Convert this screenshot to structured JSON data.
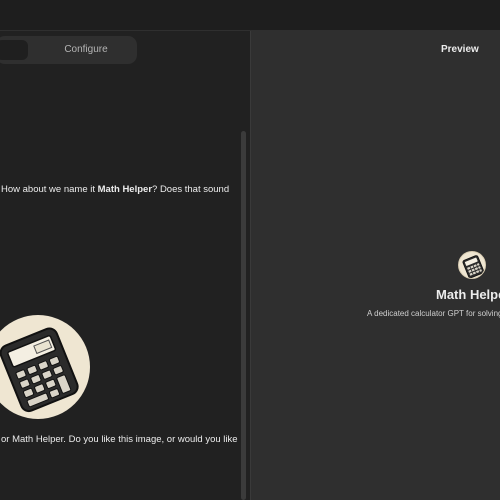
{
  "tabs": {
    "create_label": "",
    "configure_label": "Configure"
  },
  "chat": {
    "message_1": {
      "before": "How about we name it ",
      "name": "Math Helper",
      "after": "? Does that sound"
    },
    "image_alt": "calculator-image",
    "message_2": "or Math Helper. Do you like this image, or would you like"
  },
  "preview": {
    "label": "Preview",
    "gpt_name": "Math Helpe",
    "gpt_description": "A dedicated calculator GPT for solving"
  },
  "colors": {
    "background": "#212121",
    "preview_background": "#2f2f2f",
    "avatar_background": "#efe6d2",
    "text": "#ececec"
  }
}
